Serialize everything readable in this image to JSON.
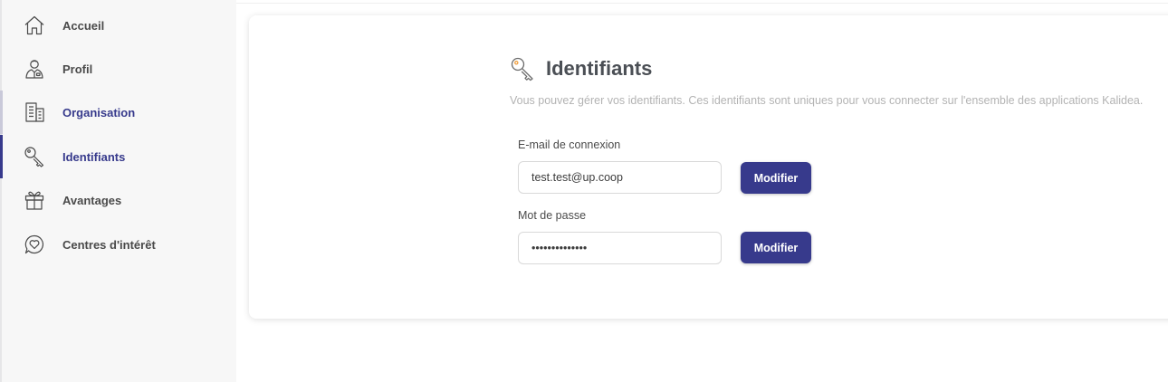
{
  "sidebar": {
    "items": [
      {
        "label": "Accueil",
        "icon": "home-icon",
        "state": "default"
      },
      {
        "label": "Profil",
        "icon": "user-badge-icon",
        "state": "default"
      },
      {
        "label": "Organisation",
        "icon": "building-icon",
        "state": "hover"
      },
      {
        "label": "Identifiants",
        "icon": "key-icon",
        "state": "active"
      },
      {
        "label": "Avantages",
        "icon": "gift-icon",
        "state": "default"
      },
      {
        "label": "Centres d'intérêt",
        "icon": "heart-chat-icon",
        "state": "default"
      }
    ]
  },
  "main": {
    "title": "Identifiants",
    "title_icon": "key-icon",
    "description": "Vous pouvez gérer vos identifiants. Ces identifiants sont uniques pour vous connecter sur l'ensemble des applications Kalidea.",
    "email": {
      "label": "E-mail de connexion",
      "value": "test.test@up.coop",
      "button_label": "Modifier"
    },
    "password": {
      "label": "Mot de passe",
      "value": "••••••••••••••",
      "button_label": "Modifier"
    }
  },
  "colors": {
    "accent": "#373a8c",
    "sidebar_background": "#f7f7f7",
    "text": "#4a4a4a",
    "description": "#b3b3b3"
  }
}
